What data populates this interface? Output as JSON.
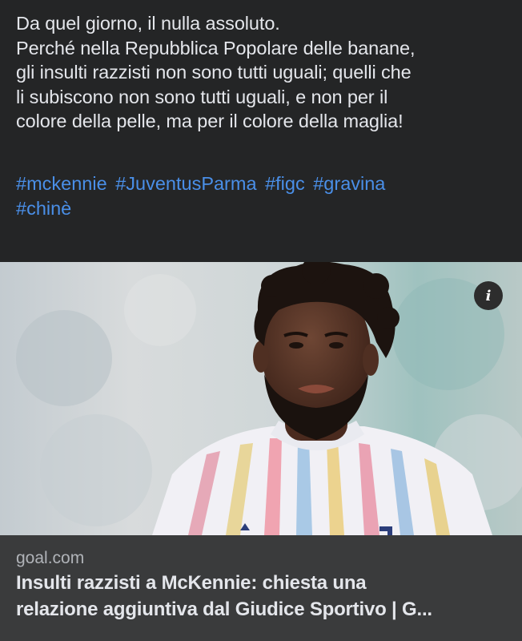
{
  "post": {
    "text_lines": [
      "Da quel giorno, il nulla assoluto.",
      "Perché nella Repubblica Popolare delle banane,",
      "gli insulti razzisti non sono tutti uguali; quelli che",
      "li subiscono non sono tutti uguali, e non per il",
      "colore della pelle, ma per il colore della maglia!"
    ],
    "hashtags": [
      "#mckennie",
      "#JuventusParma",
      "#figc",
      "#gravina",
      "#chinè"
    ]
  },
  "link_card": {
    "info_icon": "info-icon",
    "info_glyph": "i",
    "domain": "goal.com",
    "headline_lines": [
      "Insulti razzisti a McKennie: chiesta una",
      "relazione aggiuntiva dal Giudice Sportivo | G..."
    ]
  },
  "colors": {
    "background": "#242526",
    "text": "#e4e6eb",
    "hashtag": "#4a8fe8",
    "card_footer": "#3a3b3c",
    "muted": "#b0b3b8"
  }
}
